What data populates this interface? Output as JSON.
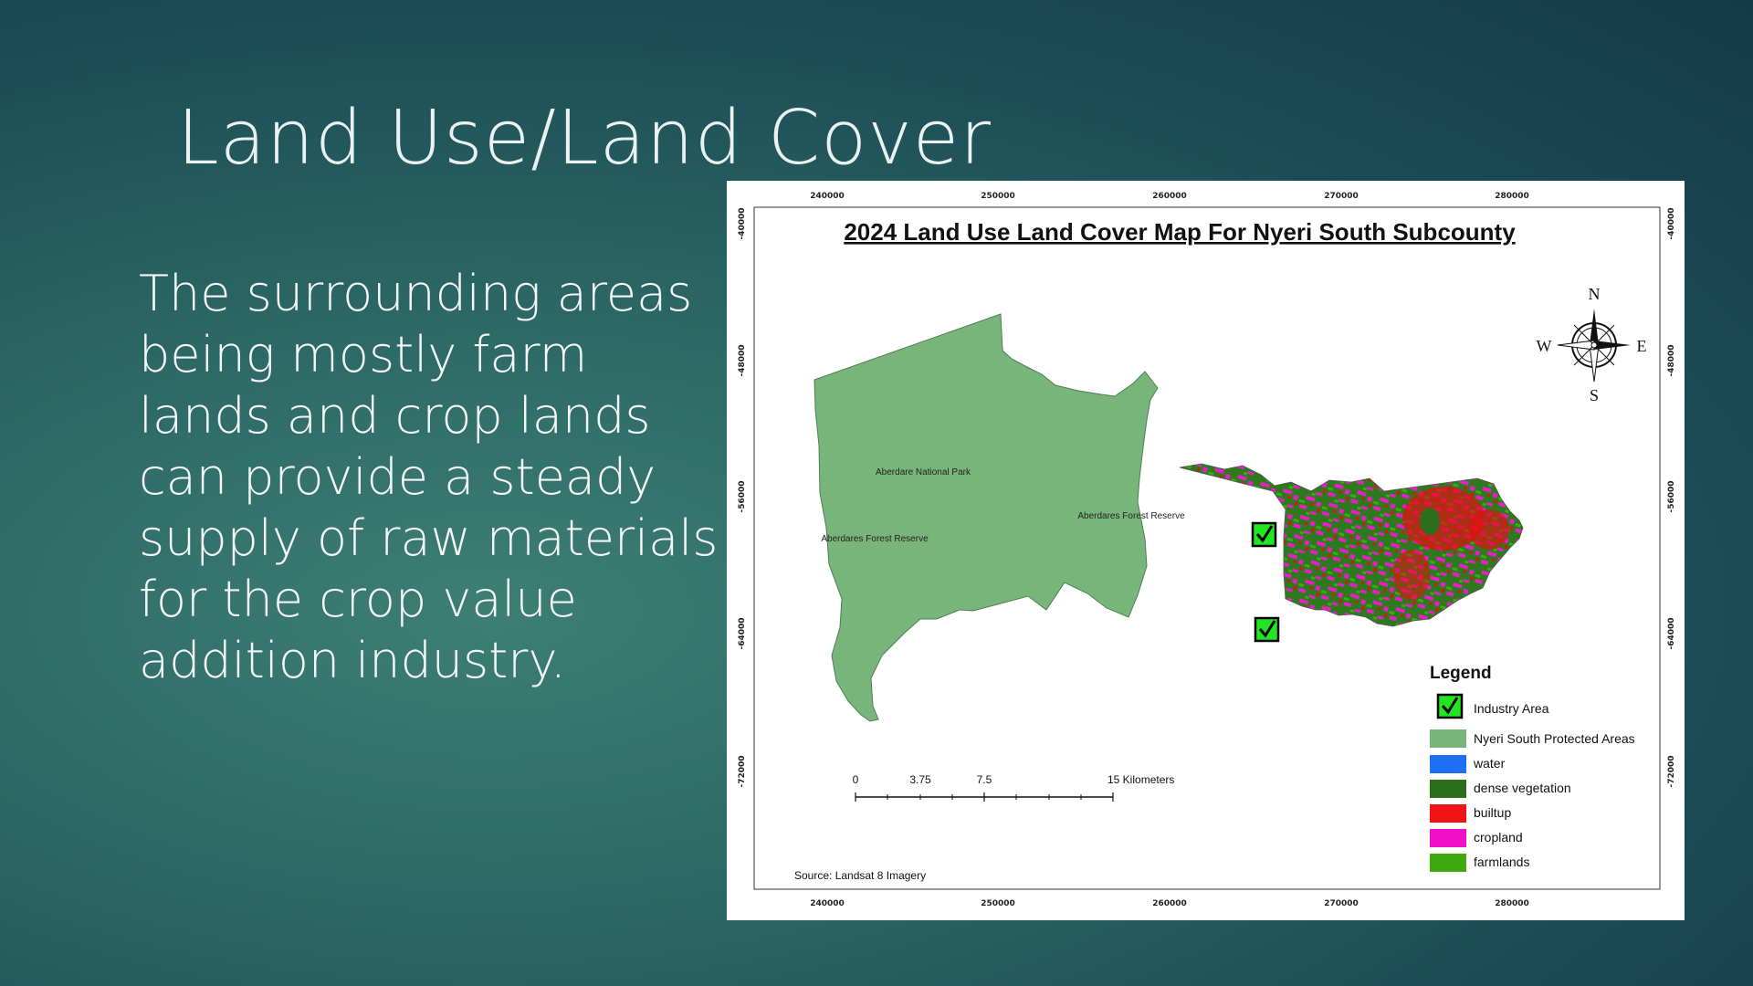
{
  "slide": {
    "title": "Land Use/Land Cover",
    "body": "The surrounding areas being mostly farm lands and crop lands can provide a steady supply of raw materials for the crop value addition industry."
  },
  "map": {
    "title": "2024 Land Use Land Cover Map For Nyeri South Subcounty",
    "x_ticks": [
      "240000",
      "250000",
      "260000",
      "270000",
      "280000"
    ],
    "y_ticks": [
      "-40000",
      "-48000",
      "-56000",
      "-64000",
      "-72000"
    ],
    "labels": {
      "aberdare_national_park": "Aberdare National Park",
      "aberdares_forest_reserve_west": "Aberdares Forest Reserve",
      "aberdares_forest_reserve_east": "Aberdares Forest Reserve"
    },
    "compass": {
      "n": "N",
      "s": "S",
      "e": "E",
      "w": "W"
    },
    "scale_bar": {
      "labels": [
        "0",
        "3.75",
        "7.5",
        "15 Kilometers"
      ]
    },
    "source": "Source: Landsat 8 Imagery",
    "legend": {
      "title": "Legend",
      "items": [
        {
          "label": "Industry Area",
          "color": "#22e622",
          "icon": "checkmark-icon"
        },
        {
          "label": "Nyeri South Protected Areas",
          "color": "#78b57b"
        },
        {
          "label": "water",
          "color": "#1e6ff2"
        },
        {
          "label": "dense vegetation",
          "color": "#2c6e1c"
        },
        {
          "label": "builtup",
          "color": "#f01414"
        },
        {
          "label": "cropland",
          "color": "#f010c8"
        },
        {
          "label": "farmlands",
          "color": "#3caa10"
        }
      ]
    }
  }
}
